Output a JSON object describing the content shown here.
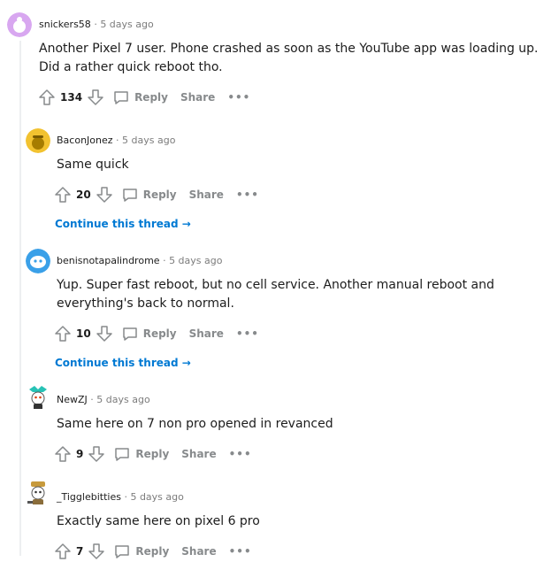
{
  "comments": [
    {
      "user": "snickers58",
      "time": "5 days ago",
      "line1": "Another Pixel 7 user. Phone crashed as soon as the YouTube app was loading up.",
      "line2": "Did a rather quick reboot tho.",
      "score": "134",
      "reply": "Reply",
      "share": "Share"
    },
    {
      "user": "BaconJonez",
      "time": "5 days ago",
      "line1": "Same quick",
      "line2": "",
      "score": "20",
      "reply": "Reply",
      "share": "Share"
    },
    {
      "user": "benisnotapalindrome",
      "time": "5 days ago",
      "line1": "Yup. Super fast reboot, but no cell service. Another manual reboot and",
      "line2": "everything's back to normal.",
      "score": "10",
      "reply": "Reply",
      "share": "Share"
    },
    {
      "user": "NewZJ",
      "time": "5 days ago",
      "line1": "Same here on 7 non pro opened in revanced",
      "line2": "",
      "score": "9",
      "reply": "Reply",
      "share": "Share"
    },
    {
      "user": "_Tigglebitties",
      "time": "5 days ago",
      "line1": "Exactly same here on pixel 6 pro",
      "line2": "",
      "score": "7",
      "reply": "Reply",
      "share": "Share"
    }
  ],
  "continue_label": "Continue this thread",
  "separator": "·",
  "more_label": "•••",
  "colors": {
    "link": "#0079d3",
    "meta": "#7c7c7c",
    "thread": "#edeff1"
  }
}
